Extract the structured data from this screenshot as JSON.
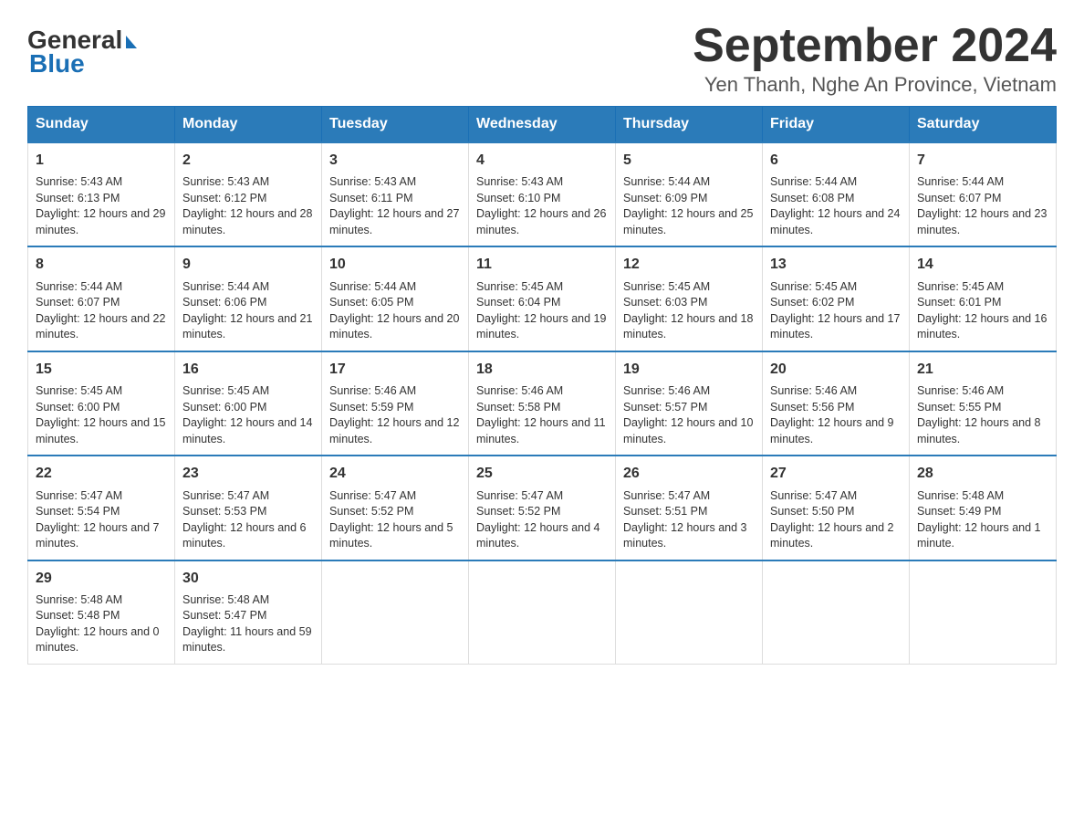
{
  "logo": {
    "general": "General",
    "blue": "Blue"
  },
  "title": "September 2024",
  "subtitle": "Yen Thanh, Nghe An Province, Vietnam",
  "days_of_week": [
    "Sunday",
    "Monday",
    "Tuesday",
    "Wednesday",
    "Thursday",
    "Friday",
    "Saturday"
  ],
  "weeks": [
    [
      {
        "day": "1",
        "sunrise": "Sunrise: 5:43 AM",
        "sunset": "Sunset: 6:13 PM",
        "daylight": "Daylight: 12 hours and 29 minutes."
      },
      {
        "day": "2",
        "sunrise": "Sunrise: 5:43 AM",
        "sunset": "Sunset: 6:12 PM",
        "daylight": "Daylight: 12 hours and 28 minutes."
      },
      {
        "day": "3",
        "sunrise": "Sunrise: 5:43 AM",
        "sunset": "Sunset: 6:11 PM",
        "daylight": "Daylight: 12 hours and 27 minutes."
      },
      {
        "day": "4",
        "sunrise": "Sunrise: 5:43 AM",
        "sunset": "Sunset: 6:10 PM",
        "daylight": "Daylight: 12 hours and 26 minutes."
      },
      {
        "day": "5",
        "sunrise": "Sunrise: 5:44 AM",
        "sunset": "Sunset: 6:09 PM",
        "daylight": "Daylight: 12 hours and 25 minutes."
      },
      {
        "day": "6",
        "sunrise": "Sunrise: 5:44 AM",
        "sunset": "Sunset: 6:08 PM",
        "daylight": "Daylight: 12 hours and 24 minutes."
      },
      {
        "day": "7",
        "sunrise": "Sunrise: 5:44 AM",
        "sunset": "Sunset: 6:07 PM",
        "daylight": "Daylight: 12 hours and 23 minutes."
      }
    ],
    [
      {
        "day": "8",
        "sunrise": "Sunrise: 5:44 AM",
        "sunset": "Sunset: 6:07 PM",
        "daylight": "Daylight: 12 hours and 22 minutes."
      },
      {
        "day": "9",
        "sunrise": "Sunrise: 5:44 AM",
        "sunset": "Sunset: 6:06 PM",
        "daylight": "Daylight: 12 hours and 21 minutes."
      },
      {
        "day": "10",
        "sunrise": "Sunrise: 5:44 AM",
        "sunset": "Sunset: 6:05 PM",
        "daylight": "Daylight: 12 hours and 20 minutes."
      },
      {
        "day": "11",
        "sunrise": "Sunrise: 5:45 AM",
        "sunset": "Sunset: 6:04 PM",
        "daylight": "Daylight: 12 hours and 19 minutes."
      },
      {
        "day": "12",
        "sunrise": "Sunrise: 5:45 AM",
        "sunset": "Sunset: 6:03 PM",
        "daylight": "Daylight: 12 hours and 18 minutes."
      },
      {
        "day": "13",
        "sunrise": "Sunrise: 5:45 AM",
        "sunset": "Sunset: 6:02 PM",
        "daylight": "Daylight: 12 hours and 17 minutes."
      },
      {
        "day": "14",
        "sunrise": "Sunrise: 5:45 AM",
        "sunset": "Sunset: 6:01 PM",
        "daylight": "Daylight: 12 hours and 16 minutes."
      }
    ],
    [
      {
        "day": "15",
        "sunrise": "Sunrise: 5:45 AM",
        "sunset": "Sunset: 6:00 PM",
        "daylight": "Daylight: 12 hours and 15 minutes."
      },
      {
        "day": "16",
        "sunrise": "Sunrise: 5:45 AM",
        "sunset": "Sunset: 6:00 PM",
        "daylight": "Daylight: 12 hours and 14 minutes."
      },
      {
        "day": "17",
        "sunrise": "Sunrise: 5:46 AM",
        "sunset": "Sunset: 5:59 PM",
        "daylight": "Daylight: 12 hours and 12 minutes."
      },
      {
        "day": "18",
        "sunrise": "Sunrise: 5:46 AM",
        "sunset": "Sunset: 5:58 PM",
        "daylight": "Daylight: 12 hours and 11 minutes."
      },
      {
        "day": "19",
        "sunrise": "Sunrise: 5:46 AM",
        "sunset": "Sunset: 5:57 PM",
        "daylight": "Daylight: 12 hours and 10 minutes."
      },
      {
        "day": "20",
        "sunrise": "Sunrise: 5:46 AM",
        "sunset": "Sunset: 5:56 PM",
        "daylight": "Daylight: 12 hours and 9 minutes."
      },
      {
        "day": "21",
        "sunrise": "Sunrise: 5:46 AM",
        "sunset": "Sunset: 5:55 PM",
        "daylight": "Daylight: 12 hours and 8 minutes."
      }
    ],
    [
      {
        "day": "22",
        "sunrise": "Sunrise: 5:47 AM",
        "sunset": "Sunset: 5:54 PM",
        "daylight": "Daylight: 12 hours and 7 minutes."
      },
      {
        "day": "23",
        "sunrise": "Sunrise: 5:47 AM",
        "sunset": "Sunset: 5:53 PM",
        "daylight": "Daylight: 12 hours and 6 minutes."
      },
      {
        "day": "24",
        "sunrise": "Sunrise: 5:47 AM",
        "sunset": "Sunset: 5:52 PM",
        "daylight": "Daylight: 12 hours and 5 minutes."
      },
      {
        "day": "25",
        "sunrise": "Sunrise: 5:47 AM",
        "sunset": "Sunset: 5:52 PM",
        "daylight": "Daylight: 12 hours and 4 minutes."
      },
      {
        "day": "26",
        "sunrise": "Sunrise: 5:47 AM",
        "sunset": "Sunset: 5:51 PM",
        "daylight": "Daylight: 12 hours and 3 minutes."
      },
      {
        "day": "27",
        "sunrise": "Sunrise: 5:47 AM",
        "sunset": "Sunset: 5:50 PM",
        "daylight": "Daylight: 12 hours and 2 minutes."
      },
      {
        "day": "28",
        "sunrise": "Sunrise: 5:48 AM",
        "sunset": "Sunset: 5:49 PM",
        "daylight": "Daylight: 12 hours and 1 minute."
      }
    ],
    [
      {
        "day": "29",
        "sunrise": "Sunrise: 5:48 AM",
        "sunset": "Sunset: 5:48 PM",
        "daylight": "Daylight: 12 hours and 0 minutes."
      },
      {
        "day": "30",
        "sunrise": "Sunrise: 5:48 AM",
        "sunset": "Sunset: 5:47 PM",
        "daylight": "Daylight: 11 hours and 59 minutes."
      },
      null,
      null,
      null,
      null,
      null
    ]
  ]
}
